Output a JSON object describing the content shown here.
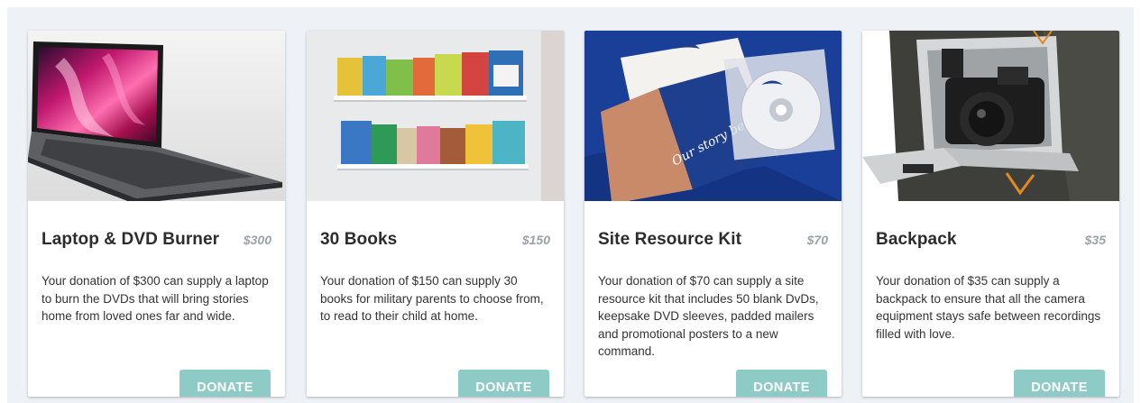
{
  "donate_label": "DONATE",
  "cards": [
    {
      "title": "Laptop & DVD Burner",
      "price": "$300",
      "description": "Your donation of $300 can supply a laptop to burn the DVDs that will bring stories home from loved ones far and wide.",
      "image": "laptop-photo"
    },
    {
      "title": "30 Books",
      "price": "$150",
      "description": "Your donation of $150 can supply 30 books for military parents to choose from, to read to their child at home.",
      "image": "books-on-shelves-photo"
    },
    {
      "title": "Site Resource Kit",
      "price": "$70",
      "description": "Your donation of $70 can supply a site resource kit that includes 50 blank DvDs, keepsake DVD sleeves, padded mailers and promotional posters to a new command.",
      "image": "resource-kit-photo",
      "image_text": "Our story begins..."
    },
    {
      "title": "Backpack",
      "price": "$35",
      "description": "Your donation of $35 can supply a backpack to ensure that all the camera equipment stays safe between recordings filled with love.",
      "image": "camera-backpack-photo"
    }
  ],
  "colors": {
    "button": "#8ecac6",
    "panel_background": "#eef2f6",
    "price": "#9aa3a8"
  }
}
